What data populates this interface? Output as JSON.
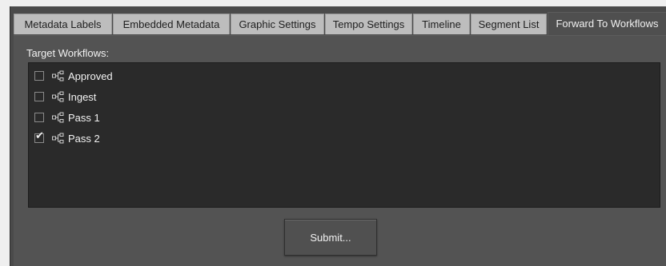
{
  "tabs": [
    {
      "label": "Metadata Labels",
      "active": false
    },
    {
      "label": "Embedded Metadata",
      "active": false
    },
    {
      "label": "Graphic Settings",
      "active": false
    },
    {
      "label": "Tempo Settings",
      "active": false
    },
    {
      "label": "Timeline",
      "active": false
    },
    {
      "label": "Segment List",
      "active": false
    },
    {
      "label": "Forward To Workflows",
      "active": true
    }
  ],
  "panel": {
    "target_label": "Target Workflows:",
    "workflows": [
      {
        "label": "Approved",
        "checked": false,
        "icon": "workflow-icon"
      },
      {
        "label": "Ingest",
        "checked": false,
        "icon": "workflow-icon"
      },
      {
        "label": "Pass 1",
        "checked": false,
        "icon": "workflow-icon"
      },
      {
        "label": "Pass 2",
        "checked": true,
        "icon": "workflow-icon"
      }
    ],
    "submit_label": "Submit..."
  },
  "colors": {
    "background": "#4a4a4a",
    "panel": "#535353",
    "listbox": "#2a2a2a",
    "tab_inactive": "#bdbdbd",
    "text_light": "#f2f2f2"
  }
}
